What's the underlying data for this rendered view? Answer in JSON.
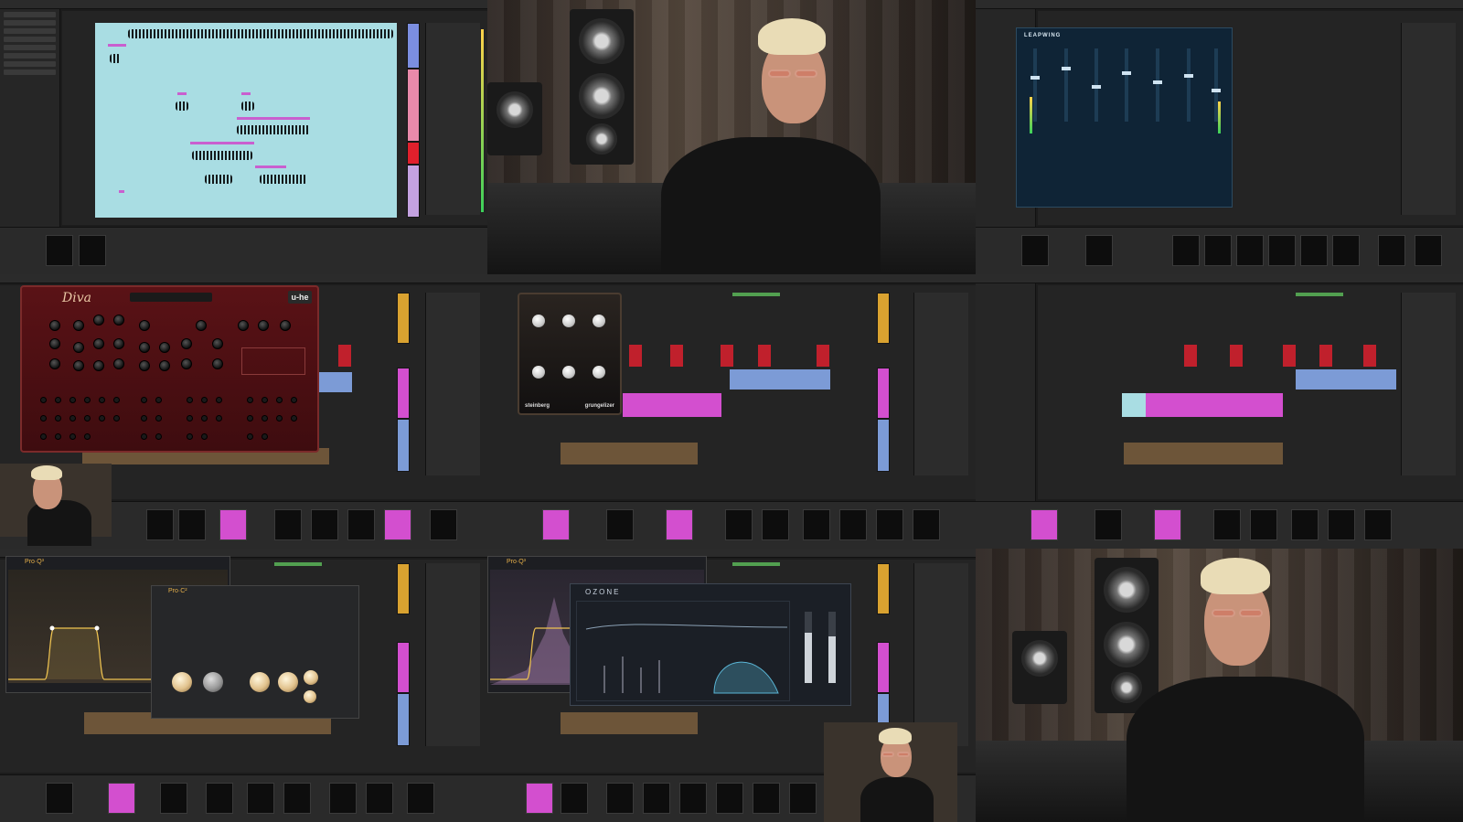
{
  "plugins": {
    "leapwing_title": "LEAPWING",
    "diva_logo": "Diva",
    "uhe_badge": "u-he",
    "grungelizer_brand_left": "steinberg",
    "grungelizer_brand_right": "grungelizer",
    "proq_top_left": "Pro·Q³",
    "proq_top_right": "Pro·Q³",
    "proc_title": "Pro·C²",
    "ozone_title": "OZONE"
  },
  "colors": {
    "audio_bg": "#a9dde3",
    "clip_red": "#c0202c",
    "clip_magenta": "#d34fcf",
    "clip_blue": "#7c9bd6",
    "clip_brown": "#6d5539",
    "track_yellow": "#d9a230",
    "diva_panel": "#5a1216",
    "leapwing_panel": "#0f2436"
  },
  "icons": [
    "steinberg-logo-icon",
    "fabfilter-logo-icon",
    "ozone-logo-icon"
  ]
}
